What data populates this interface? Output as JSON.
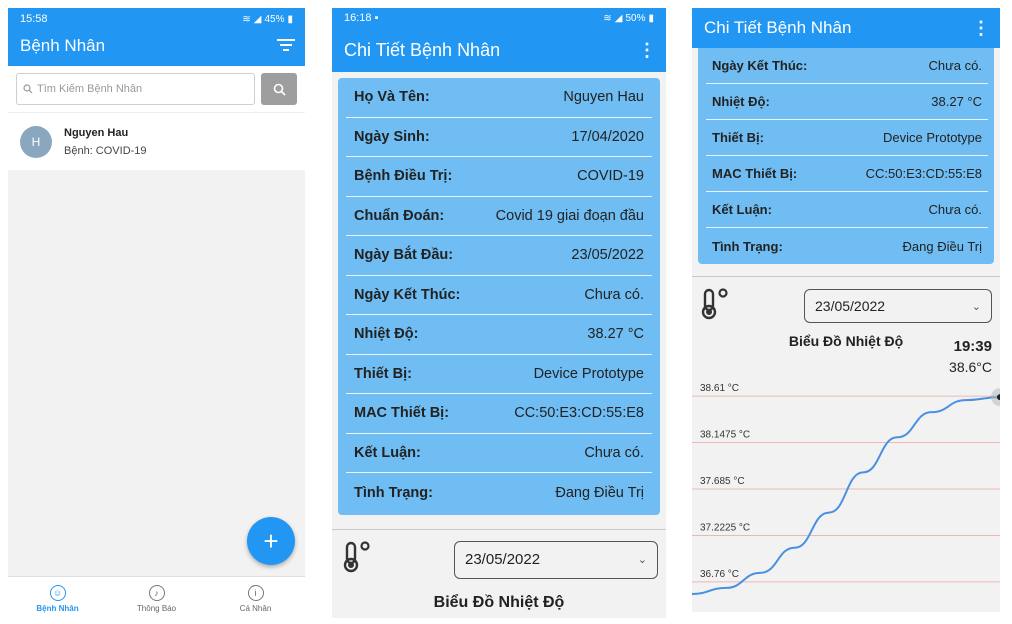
{
  "list_screen": {
    "status": {
      "time": "15:58",
      "battery": "45%"
    },
    "title": "Bệnh Nhân",
    "search_placeholder": "Tìm Kiếm Bệnh Nhân",
    "patients": [
      {
        "initial": "H",
        "name": "Nguyen Hau",
        "disease": "Bệnh: COVID-19"
      }
    ],
    "fab_label": "+",
    "nav": [
      {
        "label": "Bệnh Nhân",
        "icon": "patients-icon",
        "active": true
      },
      {
        "label": "Thông Báo",
        "icon": "bell-icon",
        "active": false
      },
      {
        "label": "Cá Nhân",
        "icon": "info-icon",
        "active": false
      }
    ]
  },
  "detail_screen": {
    "status": {
      "time": "16:18",
      "battery": "50%"
    },
    "title": "Chi Tiết Bệnh Nhân",
    "fields": [
      {
        "label": "Họ Và Tên:",
        "value": "Nguyen Hau"
      },
      {
        "label": "Ngày Sinh:",
        "value": "17/04/2020"
      },
      {
        "label": "Bệnh Điều Trị:",
        "value": "COVID-19"
      },
      {
        "label": "Chuẩn Đoán:",
        "value": "Covid 19 giai đoạn đầu"
      },
      {
        "label": "Ngày Bắt Đầu:",
        "value": "23/05/2022"
      },
      {
        "label": "Ngày Kết Thúc:",
        "value": "Chưa có."
      },
      {
        "label": "Nhiệt Độ:",
        "value": "38.27 °C"
      },
      {
        "label": "Thiết Bị:",
        "value": "Device Prototype"
      },
      {
        "label": "MAC Thiết Bị:",
        "value": "CC:50:E3:CD:55:E8"
      },
      {
        "label": "Kết Luận:",
        "value": "Chưa có."
      },
      {
        "label": "Tình Trạng:",
        "value": "Đang Điều Trị"
      }
    ],
    "date_select": "23/05/2022",
    "chart_title": "Biểu Đồ Nhiệt Độ"
  },
  "scrolled_screen": {
    "title": "Chi Tiết Bệnh Nhân",
    "fields": [
      {
        "label": "Ngày Kết Thúc:",
        "value": "Chưa có."
      },
      {
        "label": "Nhiệt Độ:",
        "value": "38.27 °C"
      },
      {
        "label": "Thiết Bị:",
        "value": "Device Prototype"
      },
      {
        "label": "MAC Thiết Bị:",
        "value": "CC:50:E3:CD:55:E8"
      },
      {
        "label": "Kết Luận:",
        "value": "Chưa có."
      },
      {
        "label": "Tình Trạng:",
        "value": "Đang Điều Trị"
      }
    ],
    "date_select": "23/05/2022",
    "chart_title": "Biểu Đồ Nhiệt Độ",
    "readout_time": "19:39",
    "readout_value": "38.6°C"
  },
  "chart_data": {
    "type": "line",
    "title": "Biểu Đồ Nhiệt Độ",
    "y_ticks": [
      "38.61 °C",
      "38.1475 °C",
      "37.685 °C",
      "37.2225 °C",
      "36.76 °C"
    ],
    "y_tick_values": [
      38.61,
      38.1475,
      37.685,
      37.2225,
      36.76
    ],
    "ylim": [
      36.5,
      38.85
    ],
    "series": [
      {
        "values": [
          36.64,
          36.7,
          36.85,
          37.1,
          37.45,
          37.85,
          38.2,
          38.45,
          38.57,
          38.6
        ]
      }
    ],
    "colors": {
      "line": "#4a90e2",
      "grid": "#f0b6b6"
    },
    "grid": true
  }
}
